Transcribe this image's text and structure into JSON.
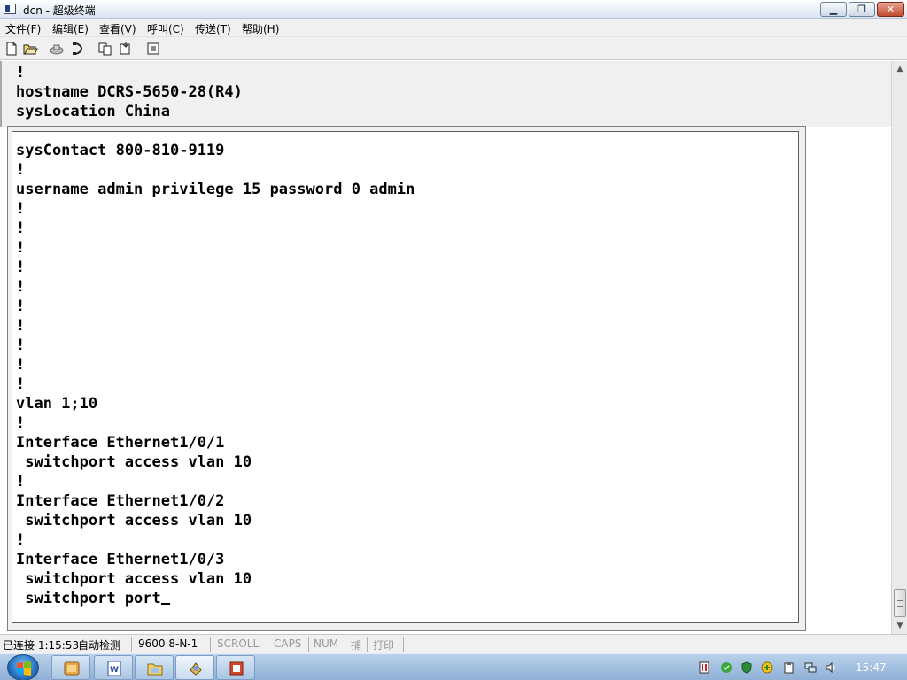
{
  "window": {
    "title": "dcn - 超级终端",
    "minimize_label": "▁",
    "maximize_label": "❐",
    "close_label": "✕"
  },
  "menu": {
    "items": [
      {
        "label": "文件(F)"
      },
      {
        "label": "编辑(E)"
      },
      {
        "label": "查看(V)"
      },
      {
        "label": "呼叫(C)"
      },
      {
        "label": "传送(T)"
      },
      {
        "label": "帮助(H)"
      }
    ]
  },
  "toolbar": {
    "icons": [
      "new-icon",
      "open-icon",
      "disconnect-icon",
      "phone-icon",
      "send-icon",
      "receive-icon",
      "properties-icon"
    ]
  },
  "terminal": {
    "lines": [
      "!",
      "hostname DCRS-5650-28(R4)",
      "sysLocation China",
      "sysContact 800-810-9119",
      "!",
      "username admin privilege 15 password 0 admin",
      "!",
      "!",
      "!",
      "!",
      "!",
      "!",
      "!",
      "!",
      "!",
      "!",
      "vlan 1;10",
      "!",
      "Interface Ethernet1/0/1",
      " switchport access vlan 10",
      "!",
      "Interface Ethernet1/0/2",
      " switchport access vlan 10",
      "!",
      "Interface Ethernet1/0/3",
      " switchport access vlan 10",
      " switchport port"
    ]
  },
  "status": {
    "connection": "已连接 1:15:53",
    "detect": "自动检测",
    "port": "9600 8-N-1",
    "scroll": "SCROLL",
    "caps": "CAPS",
    "num": "NUM",
    "capture": "捕",
    "print": "打印"
  },
  "taskbar": {
    "clock": "15:47",
    "apps": [
      "explorer-app-icon",
      "word-app-icon",
      "folder-app-icon",
      "hyperterminal-app-icon",
      "powerpoint-app-icon"
    ],
    "tray": [
      "network-tray-icon",
      "security-tray-icon",
      "shield-tray-icon",
      "ime-tray-icon",
      "clipboard-tray-icon",
      "network-status-tray-icon",
      "volume-tray-icon"
    ]
  }
}
